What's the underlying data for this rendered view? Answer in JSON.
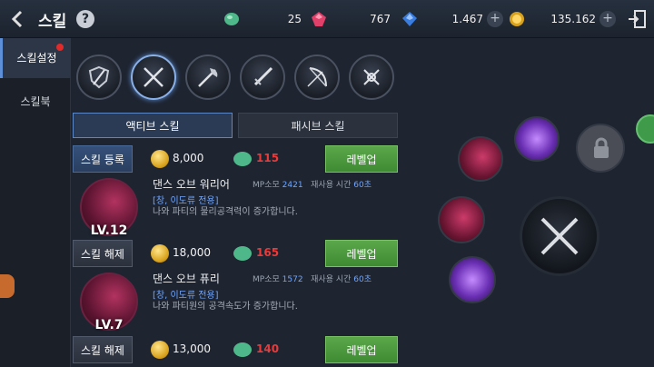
{
  "header": {
    "title": "스킬",
    "help": "?",
    "resources": [
      {
        "icon": "green-gem-icon",
        "value": "25"
      },
      {
        "icon": "red-gem-icon",
        "value": "767"
      },
      {
        "icon": "blue-diamond-icon",
        "value": "1.467"
      },
      {
        "icon": "gold-coin-icon",
        "value": "135.162"
      }
    ],
    "plus": "+"
  },
  "sidebar": {
    "items": [
      {
        "label": "스킬설정",
        "active": true
      },
      {
        "label": "스킬북",
        "active": false
      }
    ]
  },
  "tabs": {
    "active": "액티브 스킬",
    "passive": "패시브 스킬"
  },
  "skill_rows": [
    {
      "action": "스킬 등록",
      "gold": "8,000",
      "sp": "115",
      "upgrade": "레벨업"
    },
    {
      "action": "스킬 해제",
      "gold": "18,000",
      "sp": "165",
      "upgrade": "레벨업"
    },
    {
      "action": "스킬 해제",
      "gold": "13,000",
      "sp": "140",
      "upgrade": "레벨업"
    }
  ],
  "skills": [
    {
      "name": "댄스 오브 워리어",
      "mp_label": "MP소모",
      "mp": "2421",
      "cd_label": "재사용 시간",
      "cd": "60초",
      "tag": "[창, 이도류 전용]",
      "desc": "나와 파티의 물리공격력이 증가합니다.",
      "level": "LV.12"
    },
    {
      "name": "댄스 오브 퓨리",
      "mp_label": "MP소모",
      "mp": "1572",
      "cd_label": "재사용 시간",
      "cd": "60초",
      "tag": "[창, 이도류 전용]",
      "desc": "나와 파티원의 공격속도가 증가합니다.",
      "level": "LV.7"
    }
  ]
}
